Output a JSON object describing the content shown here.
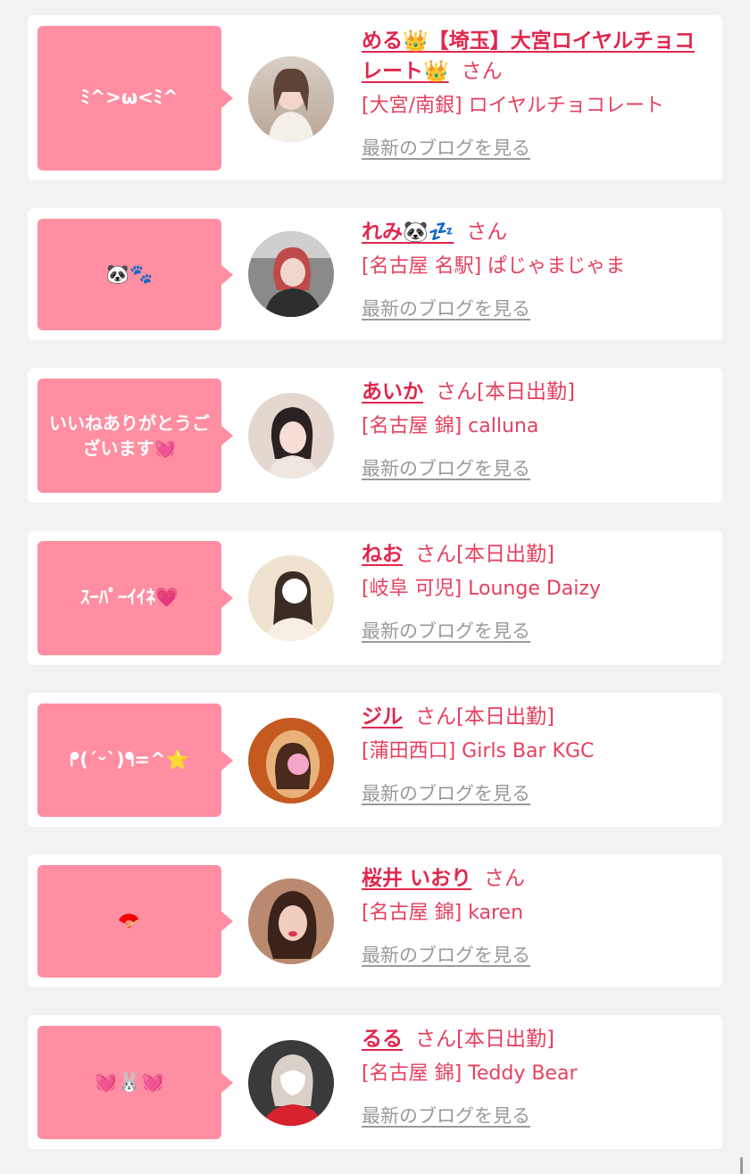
{
  "colors": {
    "bubble": "#ff8ea2",
    "name": "#e0284e",
    "text": "#e6405f",
    "link": "#9a9a9a",
    "background": "#f2f2f2"
  },
  "blog_link_label": "最新のブログを見る",
  "cards": [
    {
      "message": "ﾐ^>ω<ﾐ^",
      "name": "める👑【埼玉】大宮ロイヤルチョコレート👑",
      "suffix": "さん",
      "shop": "[大宮/南銀] ロイヤルチョコレート"
    },
    {
      "message": "🐼🐾",
      "name": "れみ🐼💤",
      "suffix": "さん",
      "shop": "[名古屋 名駅] ぱじゃまじゃま"
    },
    {
      "message": "いいねありがとうございます💓",
      "name": "あいか",
      "suffix": "さん[本日出勤]",
      "shop": "[名古屋 錦] calluna"
    },
    {
      "message": "ｽｰﾊﾟｰｲｲﾈ💗",
      "name": "ねお",
      "suffix": "さん[本日出勤]",
      "shop": "[岐阜 可児] Lounge Daizy"
    },
    {
      "message": "ᖰ(ˊᵕˋ)ᖳ=^⭐",
      "name": "ジル",
      "suffix": "さん[本日出勤]",
      "shop": "[蒲田西口] Girls Bar KGC"
    },
    {
      "message": "🪭",
      "name": "桜井 いおり",
      "suffix": "さん",
      "shop": "[名古屋 錦] karen"
    },
    {
      "message": "💓🐰💓",
      "name": "るる",
      "suffix": "さん[本日出勤]",
      "shop": "[名古屋 錦] Teddy Bear"
    }
  ]
}
